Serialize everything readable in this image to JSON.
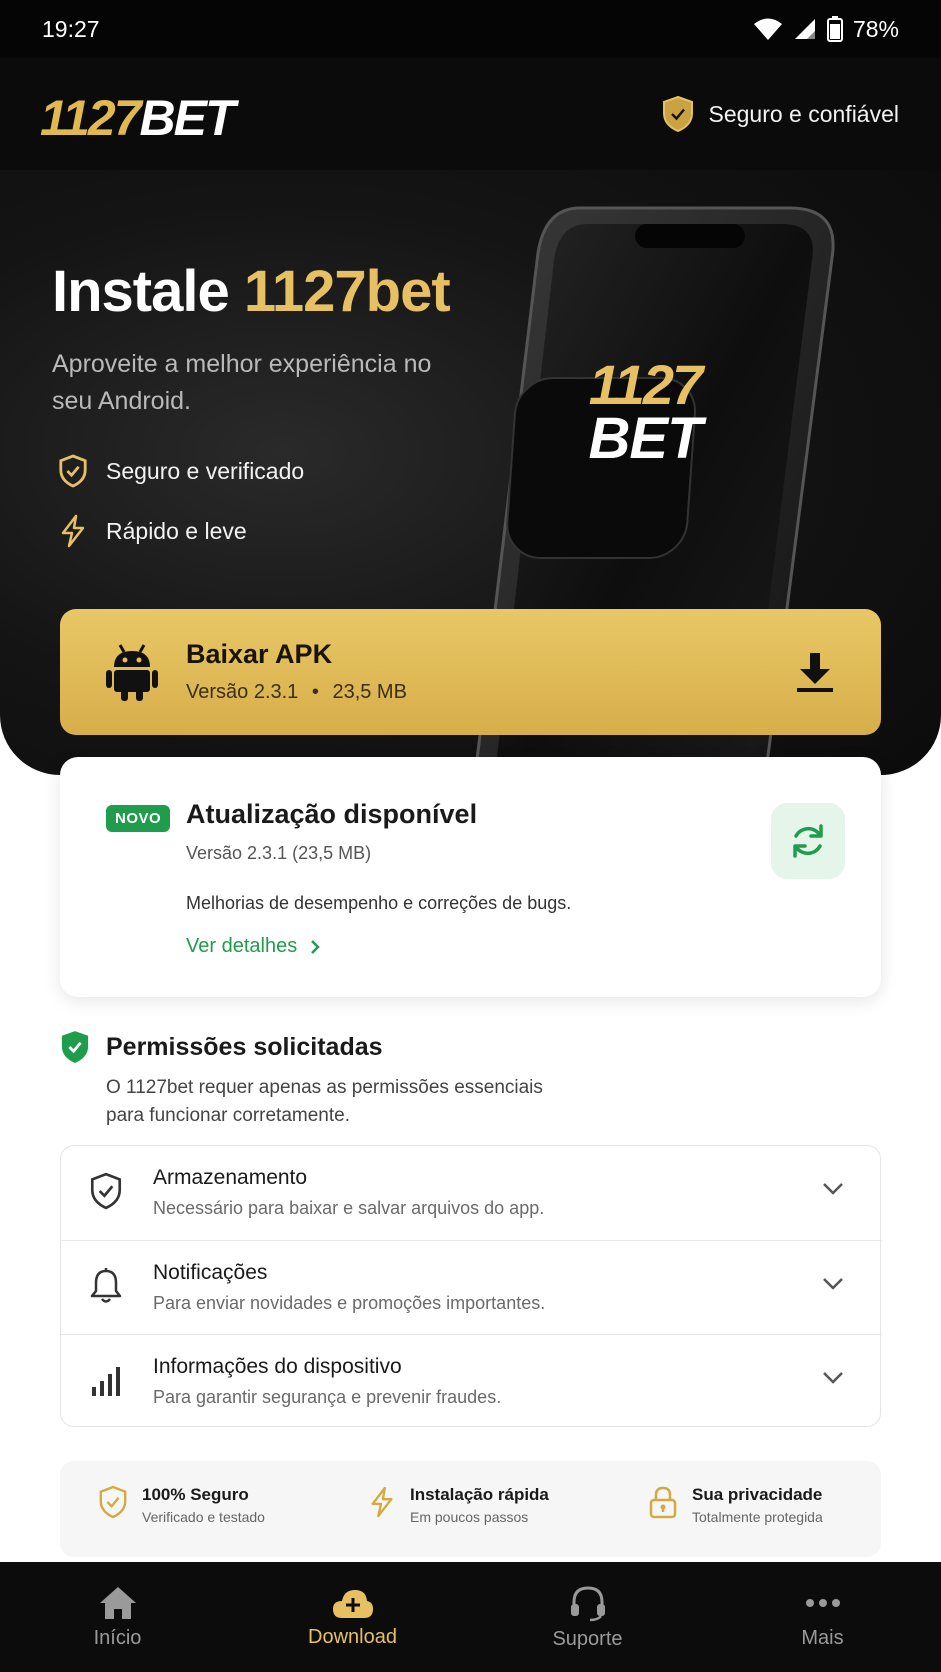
{
  "status_bar": {
    "time": "19:27",
    "battery": "78%"
  },
  "header": {
    "logo_gold": "1127",
    "logo_white": "BET",
    "trust_label": "Seguro e confiável"
  },
  "hero": {
    "title_white": "Instale ",
    "title_gold": "1127bet",
    "subtitle": "Aproveite a melhor experiência no seu Android.",
    "features": [
      "Seguro e verificado",
      "Rápido e leve"
    ],
    "phone_logo_top": "1127",
    "phone_logo_bottom": "BET"
  },
  "apk": {
    "title": "Baixar APK",
    "version": "Versão 2.3.1",
    "size": "23,5 MB",
    "separator": "•"
  },
  "update": {
    "badge": "NOVO",
    "title": "Atualização disponível",
    "version": "Versão 2.3.1 (23,5 MB)",
    "description": "Melhorias de desempenho e correções de bugs.",
    "link": "Ver detalhes"
  },
  "permissions": {
    "title": "Permissões solicitadas",
    "description": "O 1127bet requer apenas as permissões essenciais para funcionar corretamente.",
    "items": [
      {
        "name": "Armazenamento",
        "text": "Necessário para baixar e salvar arquivos do app.",
        "icon": "shield-check-icon"
      },
      {
        "name": "Notificações",
        "text": "Para enviar novidades e promoções importantes.",
        "icon": "bell-icon"
      },
      {
        "name": "Informações do dispositivo",
        "text": "Para garantir segurança e prevenir fraudes.",
        "icon": "signal-bars-icon"
      }
    ]
  },
  "trust_strip": [
    {
      "title": "100% Seguro",
      "subtitle": "Verificado e testado",
      "icon": "shield-check-icon"
    },
    {
      "title": "Instalação rápida",
      "subtitle": "Em poucos passos",
      "icon": "bolt-icon"
    },
    {
      "title": "Sua privacidade",
      "subtitle": "Totalmente protegida",
      "icon": "lock-icon"
    }
  ],
  "nav": [
    {
      "label": "Início",
      "icon": "home-icon"
    },
    {
      "label": "Download",
      "icon": "cloud-download-icon",
      "active": true
    },
    {
      "label": "Suporte",
      "icon": "headset-icon"
    },
    {
      "label": "Mais",
      "icon": "more-dots-icon"
    }
  ],
  "colors": {
    "gold": "#e6c063",
    "green": "#1f9d4c",
    "dark": "#0b0b0b"
  }
}
